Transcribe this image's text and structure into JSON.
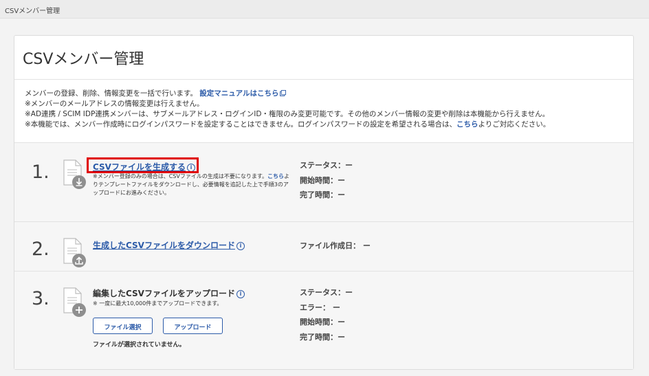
{
  "window": {
    "title": "CSVメンバー管理"
  },
  "page": {
    "title": "CSVメンバー管理"
  },
  "info": {
    "line1_text": "メンバーの登録、削除、情報変更を一括で行います。",
    "manual_link": "設定マニュアルはこちら",
    "line2": "※メンバーのメールアドレスの情報変更は行えません。",
    "line3": "※AD連携 / SCIM IDP連携メンバーは、サブメールアドレス・ログインID・権限のみ変更可能です。その他のメンバー情報の変更や削除は本機能から行えません。",
    "line4_text": "※本機能では、メンバー作成時にログインパスワードを設定することはできません。ログインパスワードの設定を希望される場合は、",
    "line4_link": "こちら",
    "line4_suffix": "よりご対応ください。"
  },
  "steps": [
    {
      "number": "1.",
      "title": "CSVファイルを生成する",
      "desc_prefix": "※メンバー登録のみの場合は、CSVファイルの生成は不要になります。",
      "desc_link": "こちら",
      "desc_suffix": "よりテンプレートファイルをダウンロードし、必要情報を追記した上で手順3のアップロードにお進みください。",
      "status": [
        "ステータス：ー",
        "開始時間：ー",
        "完了時間：ー"
      ]
    },
    {
      "number": "2.",
      "title": "生成したCSVファイルをダウンロード",
      "status": [
        "ファイル作成日： ー"
      ]
    },
    {
      "number": "3.",
      "title": "編集したCSVファイルをアップロード",
      "desc": "※ 一度に最大10,000件までアップロードできます。",
      "select_button": "ファイル選択",
      "upload_button": "アップロード",
      "file_status": "ファイルが選択されていません。",
      "status": [
        "ステータス：ー",
        "エラー： ー",
        "開始時間：ー",
        "完了時間：ー"
      ]
    }
  ],
  "info_icon": "i",
  "colors": {
    "link": "#2b5aa8",
    "highlight": "#e00000"
  }
}
